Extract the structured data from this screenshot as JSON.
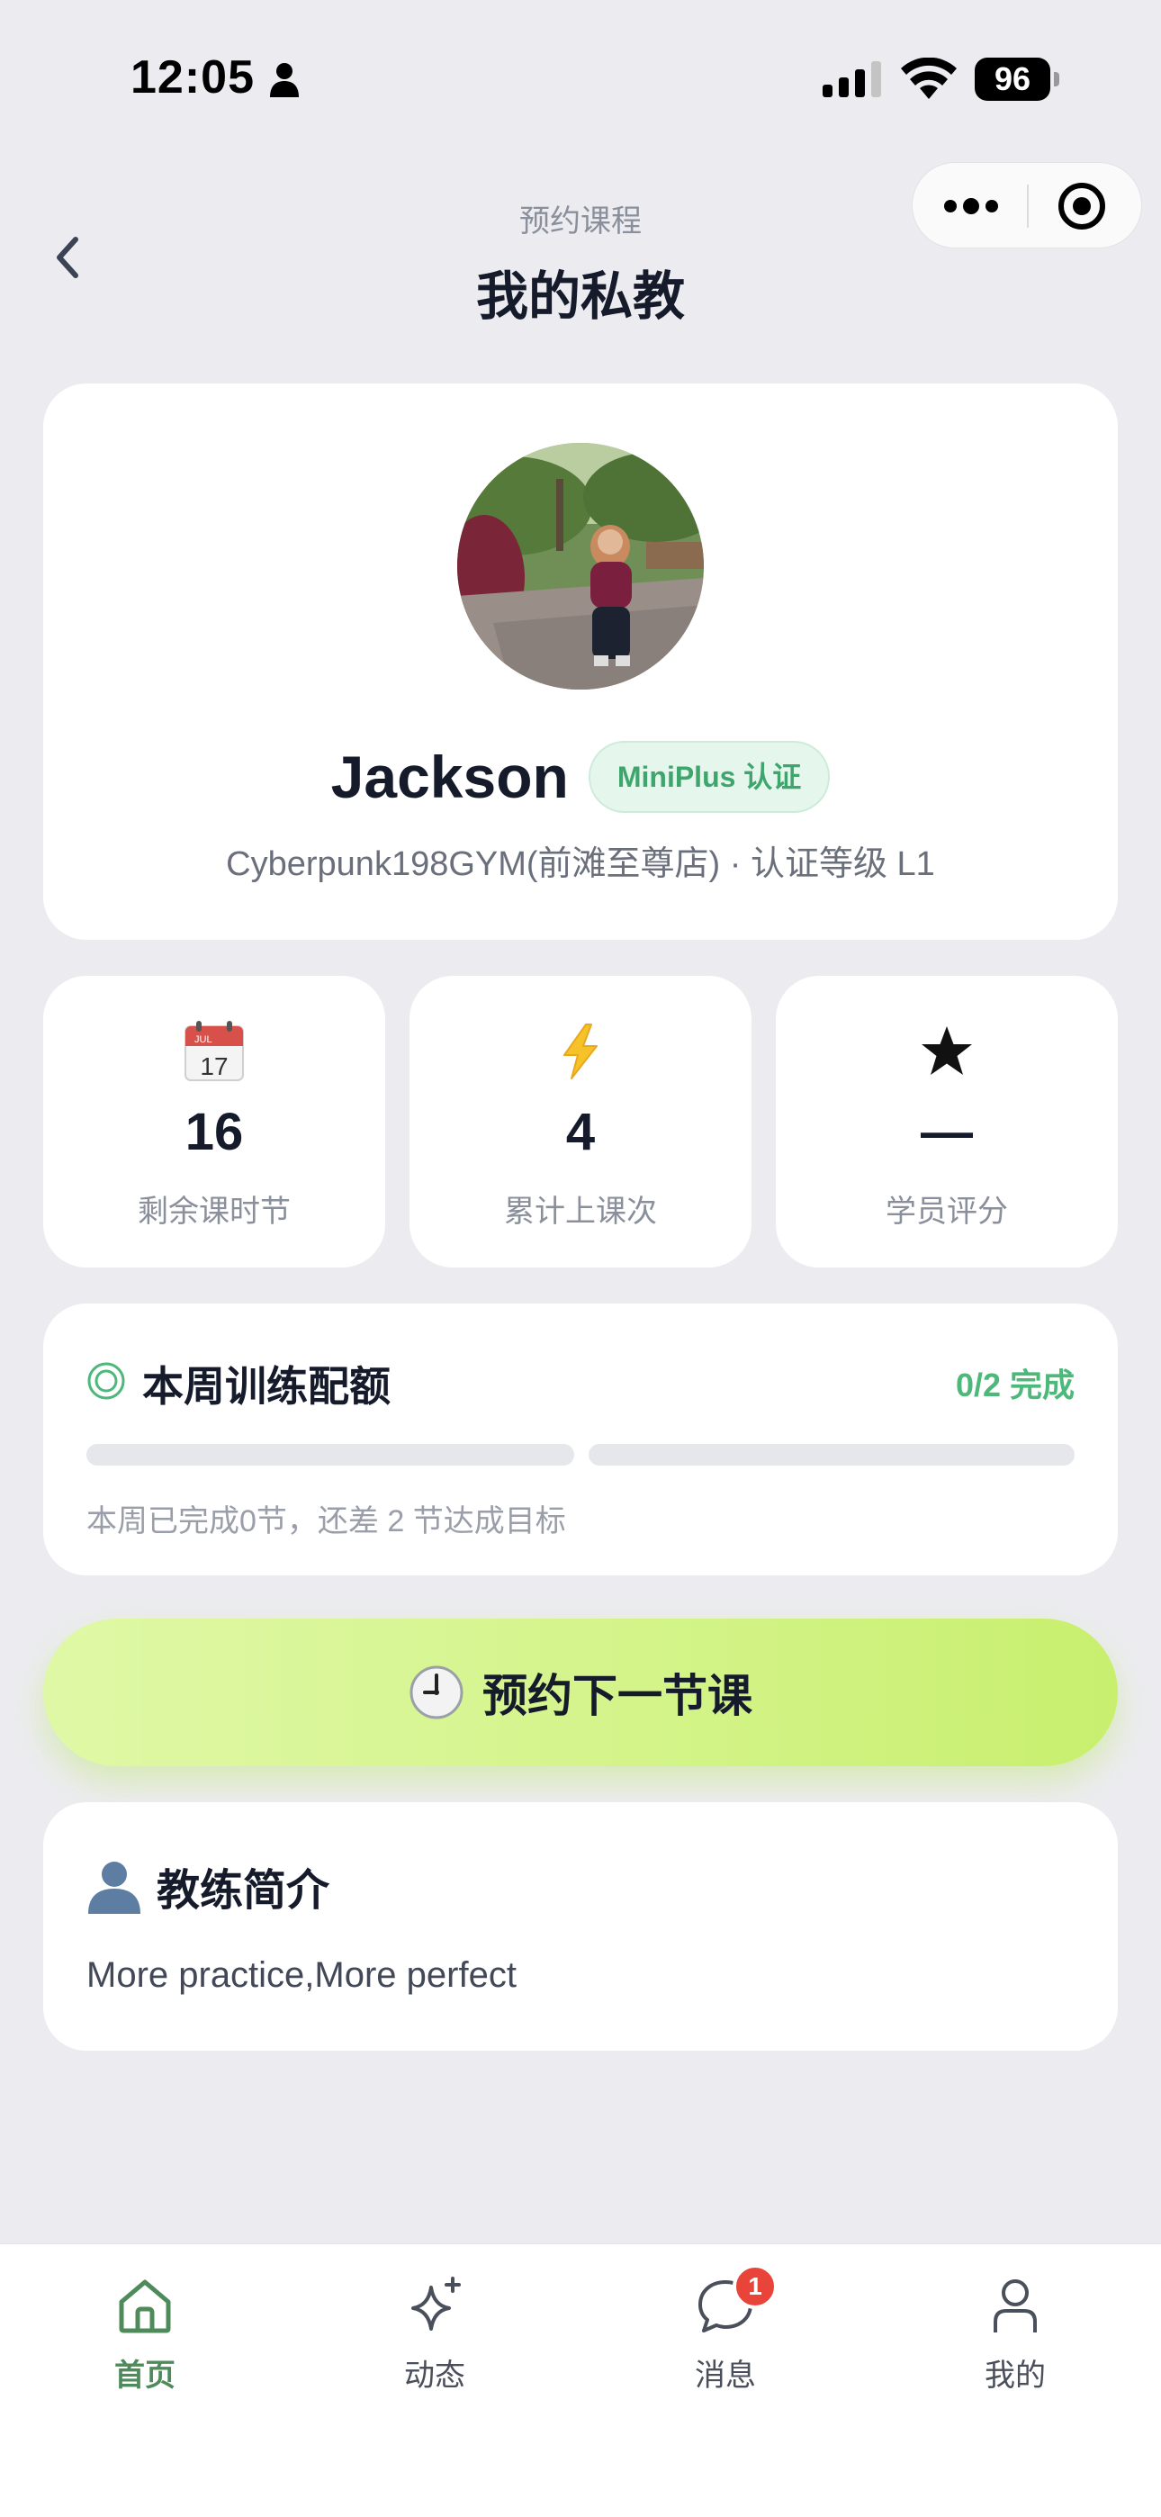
{
  "status_bar": {
    "time": "12:05",
    "battery": "96"
  },
  "nav": {
    "subtitle": "预约课程",
    "title": "我的私教"
  },
  "profile": {
    "name": "Jackson",
    "badge": "MiniPlus 认证",
    "gym_line": "Cyberpunk198GYM(前滩至尊店) · 认证等级 L1"
  },
  "stats": [
    {
      "icon": "calendar-icon",
      "calendar_month": "JUL",
      "calendar_day": "17",
      "value": "16",
      "label": "剩余课时节"
    },
    {
      "icon": "lightning-icon",
      "value": "4",
      "label": "累计上课次"
    },
    {
      "icon": "star-icon",
      "value": "—",
      "label": "学员评分"
    }
  ],
  "quota": {
    "title": "本周训练配额",
    "status": "0/2 完成",
    "completed": 0,
    "target": 2,
    "note": "本周已完成0节，还差 2 节达成目标"
  },
  "cta": {
    "label": "预约下一节课",
    "icon": "clock-icon"
  },
  "intro": {
    "title": "教练简介",
    "text": "More practice,More perfect",
    "icon": "person-silhouette-icon"
  },
  "tabs": [
    {
      "label": "首页",
      "icon": "home-icon",
      "active": true
    },
    {
      "label": "动态",
      "icon": "sparkle-icon"
    },
    {
      "label": "消息",
      "icon": "chat-icon",
      "badge": "1"
    },
    {
      "label": "我的",
      "icon": "user-icon"
    }
  ],
  "colors": {
    "accent_green": "#4cb879",
    "cta_lime": "#d4f48a",
    "tab_active": "#4f8a5b",
    "badge_red": "#e8443a"
  }
}
